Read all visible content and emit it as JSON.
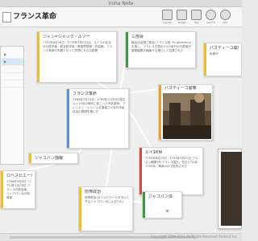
{
  "window": {
    "title": "iroha Note"
  },
  "document": {
    "title": "フランス革命"
  },
  "toolbar": {
    "buttons": [
      {
        "name": "layout",
        "label": "Layout"
      },
      {
        "name": "image",
        "label": "Image"
      },
      {
        "name": "tag",
        "label": "Tag"
      },
      {
        "name": "search",
        "label": "Search"
      },
      {
        "name": "info",
        "label": "Info"
      }
    ]
  },
  "cards": [
    {
      "title": "ジャン=ジャック・ルソー",
      "body": "1712年6月28日 - 1778年7月2日)は、スイスの生まれの哲学者・政治哲学者・教育思想家・作曲家。フランス革命の先駆となった思想に大きな影響",
      "color": "#f0c020"
    },
    {
      "title": "三部会",
      "body": "議会は全国三部会(フランス語: Ps généraux)を指し、フランス王国の3つの身分の代表者が重要議題を議論する場として召集された",
      "color": "#3a9b3a"
    },
    {
      "title": "バスティーユ襲撃",
      "body": "民衆が",
      "color": "#f0c020"
    },
    {
      "title": "フランス革命",
      "body": "1789年7月14日 - 1799年11月9日 国王ルイ16世の時代に起こった市民革命。アンシャン・レジームを崩壊させ近代市民社会の基礎を築いた",
      "color": "#5d8ed6"
    },
    {
      "title": "ジャコバン独裁",
      "body": "",
      "color": "#f0c020"
    },
    {
      "title": "ルイ16世",
      "body": "1754年8月23日 - 1793年1月21日 ブルボン朝第5代フランス国王。在位1774年 - 1792年。革命の中で処刑された",
      "color": "#d9473a"
    },
    {
      "title": "恐怖政治",
      "body": "恐怖政治(ロベスピエールを中心とするジャコバン派によるもの)",
      "color": "#f0c020"
    },
    {
      "title": "ロベスピエール",
      "body": "1758年5月6日 - 1794年7月28日 フランスの政治家。ジャコバン派の指導者",
      "color": "#f0c020"
    },
    {
      "title": "ジャコバン派",
      "body": "",
      "color": "#3a9b3a"
    }
  ],
  "image_card": {
    "title": "バスティーユ襲撃"
  },
  "statusbar": {
    "copyright": "Copyright 2009-2013 All Rights Reserved Android Inc."
  }
}
